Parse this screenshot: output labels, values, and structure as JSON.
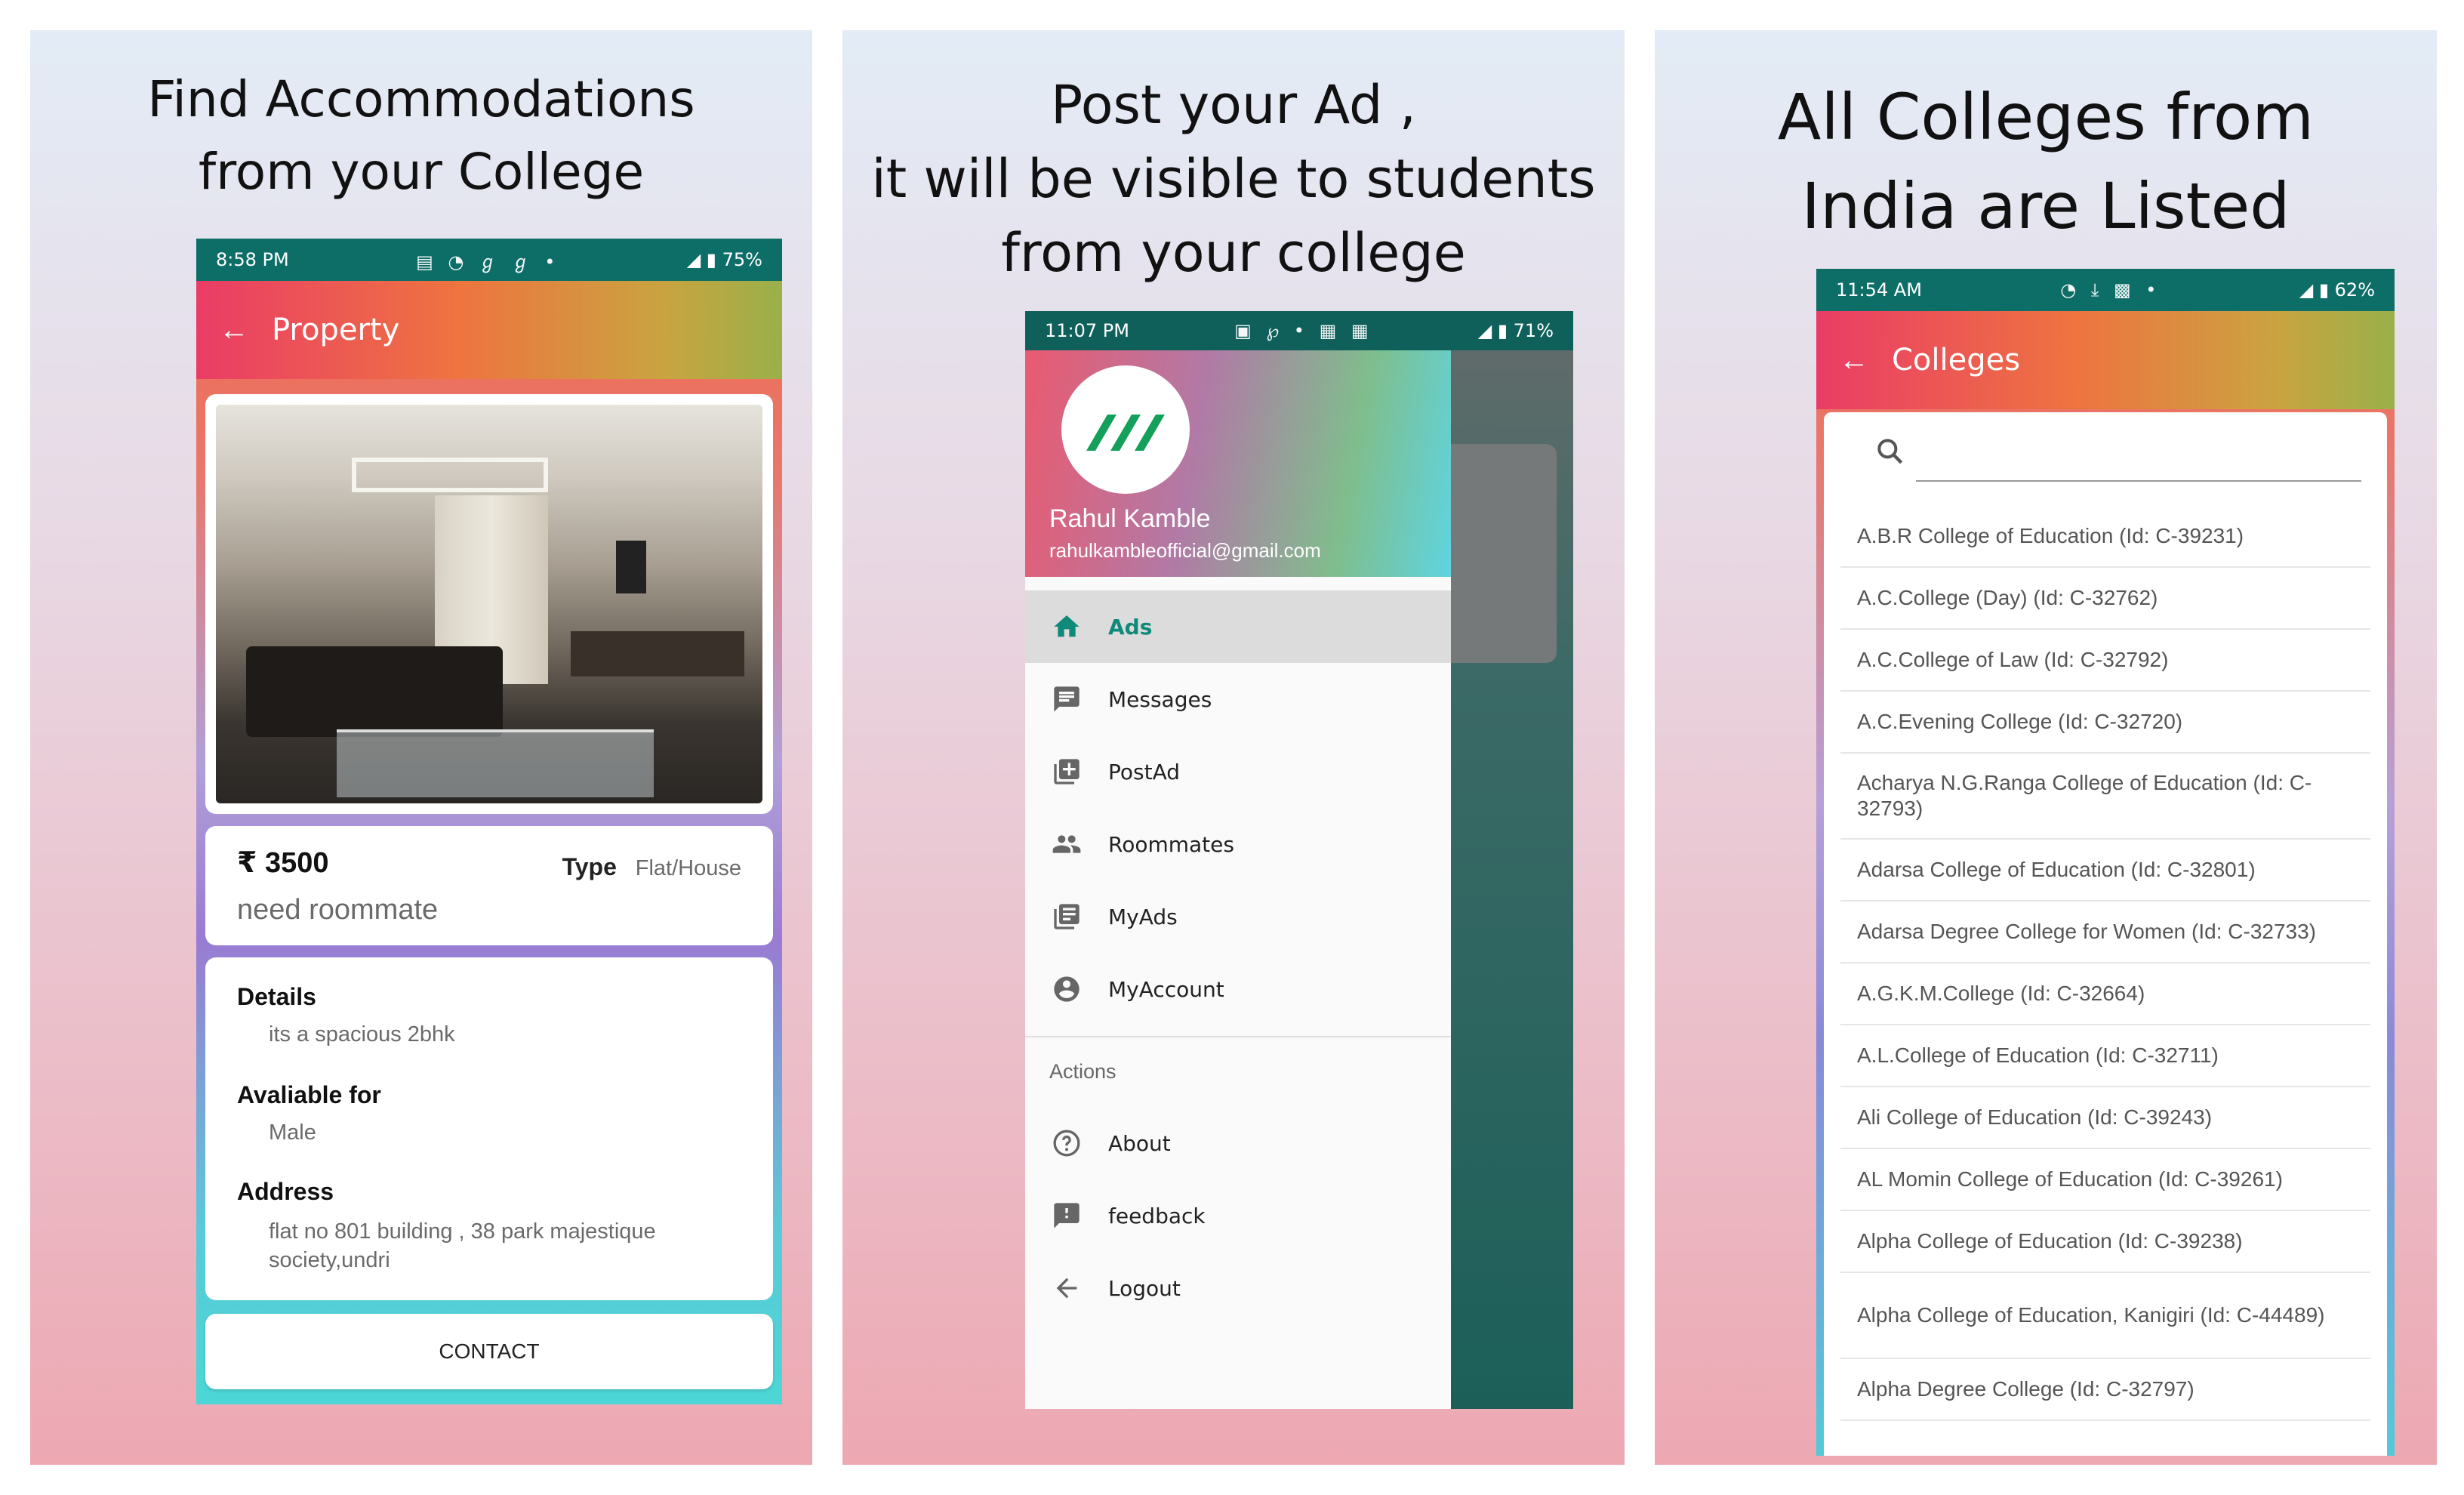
{
  "panel1": {
    "headline": [
      "Find Accommodations",
      "from your College"
    ],
    "status": {
      "time": "8:58 PM",
      "battery": "75%"
    },
    "appbar_title": "Property",
    "price": "₹ 3500",
    "type_label": "Type",
    "type_value": "Flat/House",
    "subtitle": "need roommate",
    "details_label": "Details",
    "details_value": "its a spacious 2bhk",
    "available_label": "Avaliable for",
    "available_value": "Male",
    "address_label": "Address",
    "address_value": "flat no 801 building , 38 park majestique society,undri",
    "contact_button": "CONTACT"
  },
  "panel2": {
    "headline": [
      "Post your Ad ,",
      "it will be visible to students",
      "from your college"
    ],
    "status": {
      "time": "11:07 PM",
      "battery": "71%"
    },
    "user_name": "Rahul Kamble",
    "user_email": "rahulkambleofficial@gmail.com",
    "menu": [
      {
        "label": "Ads",
        "icon": "home-icon"
      },
      {
        "label": "Messages",
        "icon": "message-icon"
      },
      {
        "label": "PostAd",
        "icon": "add-box-icon"
      },
      {
        "label": "Roommates",
        "icon": "people-icon"
      },
      {
        "label": "MyAds",
        "icon": "library-icon"
      },
      {
        "label": "MyAccount",
        "icon": "account-circle-icon"
      }
    ],
    "actions_header": "Actions",
    "actions": [
      {
        "label": "About",
        "icon": "help-icon"
      },
      {
        "label": "feedback",
        "icon": "feedback-icon"
      },
      {
        "label": "Logout",
        "icon": "arrow-back-icon"
      }
    ],
    "accent": "#0f8a7a"
  },
  "panel3": {
    "headline": [
      "All Colleges from",
      "India are Listed"
    ],
    "status": {
      "time": "11:54 AM",
      "battery": "62%"
    },
    "appbar_title": "Colleges",
    "search_placeholder": "",
    "colleges": [
      "A.B.R College of Education (Id: C-39231)",
      "A.C.College (Day) (Id: C-32762)",
      "A.C.College of Law (Id: C-32792)",
      "A.C.Evening College (Id: C-32720)",
      "Acharya N.G.Ranga College of Education (Id: C-32793)",
      "Adarsa College of Education (Id: C-32801)",
      "Adarsa Degree College for Women (Id: C-32733)",
      "A.G.K.M.College (Id: C-32664)",
      "A.L.College of Education (Id: C-32711)",
      "Ali College of Education (Id: C-39243)",
      "AL Momin College of Education (Id: C-39261)",
      "Alpha College of Education (Id: C-39238)",
      "Alpha College of Education, Kanigiri (Id: C-44489)",
      "Alpha Degree College (Id: C-32797)"
    ]
  }
}
